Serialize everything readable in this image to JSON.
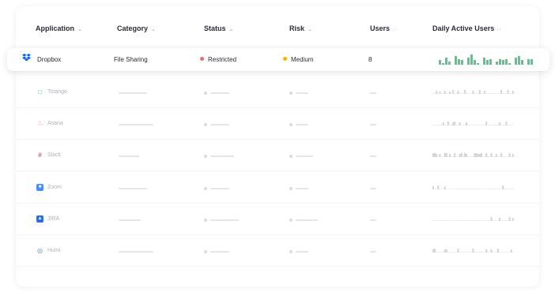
{
  "columns": [
    {
      "label": "Application",
      "indicator": "caret"
    },
    {
      "label": "Category",
      "indicator": "caret"
    },
    {
      "label": "Status",
      "indicator": "caret"
    },
    {
      "label": "Risk",
      "indicator": "caret"
    },
    {
      "label": "Users",
      "indicator": "sort"
    },
    {
      "label": "Daily Active Users",
      "indicator": "sort"
    }
  ],
  "featured": {
    "app": "Dropbox",
    "icon": "dropbox-icon",
    "category": "File Sharing",
    "status": "Restricted",
    "status_color": "#f26b6b",
    "risk": "Medium",
    "risk_color": "#f5b400",
    "users": "8",
    "spark_color": "#5cc58f",
    "dau": [
      3,
      1,
      5,
      2,
      0,
      6,
      4,
      3,
      0,
      5,
      7,
      3,
      1,
      0,
      5,
      3,
      4,
      0,
      2,
      4,
      3,
      4,
      1,
      0,
      5,
      6,
      3,
      0,
      4,
      4
    ]
  },
  "rows": [
    {
      "app": "Totango",
      "icon": "totango-icon",
      "icon_color": "#3bbf8a"
    },
    {
      "app": "Asana",
      "icon": "asana-icon",
      "icon_color": "#f06a6a"
    },
    {
      "app": "Slack",
      "icon": "slack-icon",
      "icon_color": "#e01e5a"
    },
    {
      "app": "Zoom",
      "icon": "zoom-icon",
      "icon_color": "#4a8cff"
    },
    {
      "app": "JIRA",
      "icon": "jira-icon",
      "icon_color": "#2f6fdb"
    },
    {
      "app": "Humi",
      "icon": "humi-icon",
      "icon_color": "#3b8bd6"
    }
  ]
}
